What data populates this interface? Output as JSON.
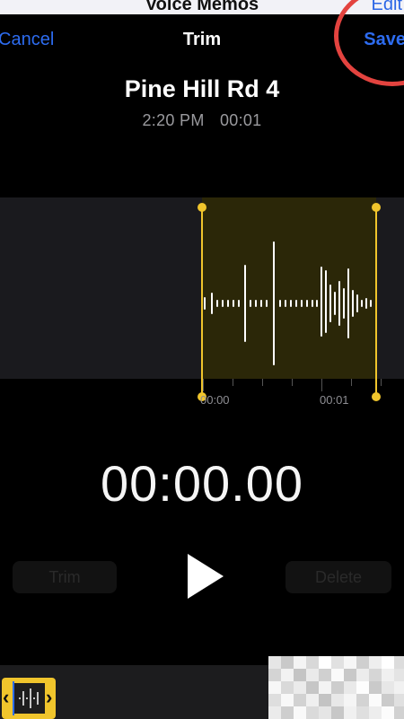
{
  "background_app": {
    "title": "Voice Memos",
    "edit_label": "Edit"
  },
  "nav": {
    "cancel_label": "Cancel",
    "title": "Trim",
    "save_label": "Save"
  },
  "recording": {
    "name": "Pine Hill Rd 4",
    "time": "2:20 PM",
    "duration": "00:01"
  },
  "timeline": {
    "tick_labels": [
      "00:00",
      "00:01"
    ]
  },
  "playback": {
    "timer": "00:00.00",
    "trim_label": "Trim",
    "delete_label": "Delete"
  },
  "colors": {
    "accent_blue": "#2d6cf0",
    "trim_yellow": "#f0c52c",
    "annotation_red": "#e3433f"
  },
  "icons": {
    "play": "play-icon",
    "mini_chevrons": "chevron-icons"
  }
}
